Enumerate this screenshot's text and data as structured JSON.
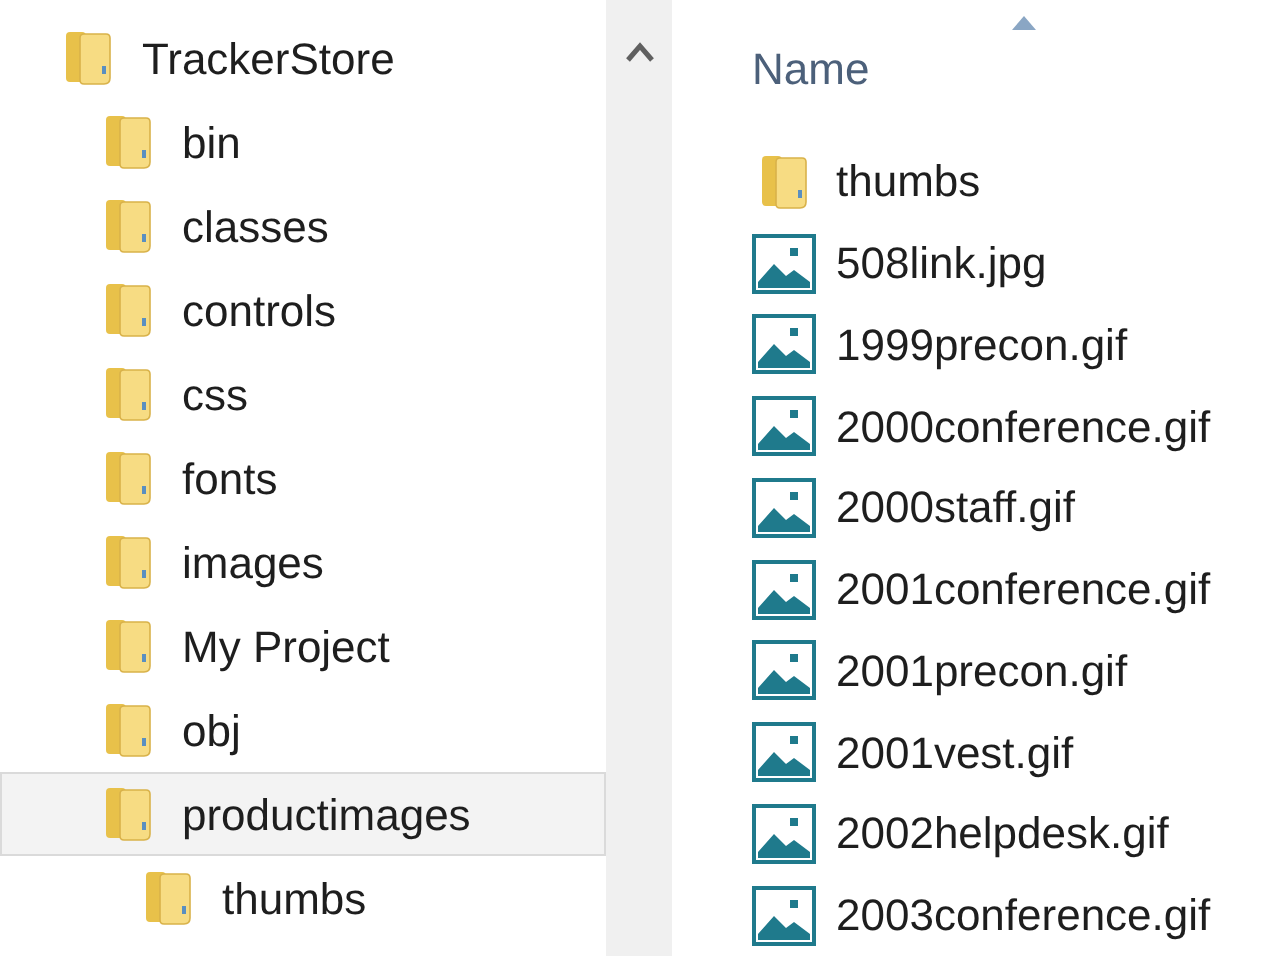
{
  "tree": [
    {
      "label": "TrackerStore",
      "selected": false,
      "children": [
        {
          "label": "bin",
          "selected": false
        },
        {
          "label": "classes",
          "selected": false
        },
        {
          "label": "controls",
          "selected": false
        },
        {
          "label": "css",
          "selected": false
        },
        {
          "label": "fonts",
          "selected": false
        },
        {
          "label": "images",
          "selected": false
        },
        {
          "label": "My Project",
          "selected": false
        },
        {
          "label": "obj",
          "selected": false
        },
        {
          "label": "productimages",
          "selected": true,
          "children": [
            {
              "label": "thumbs",
              "selected": false
            }
          ]
        }
      ]
    }
  ],
  "file_list": {
    "columns": [
      "Name"
    ],
    "items": [
      {
        "kind": "folder",
        "name": "thumbs"
      },
      {
        "kind": "image",
        "name": "508link.jpg"
      },
      {
        "kind": "image",
        "name": "1999precon.gif"
      },
      {
        "kind": "image",
        "name": "2000conference.gif"
      },
      {
        "kind": "image",
        "name": "2000staff.gif"
      },
      {
        "kind": "image",
        "name": "2001conference.gif"
      },
      {
        "kind": "image",
        "name": "2001precon.gif"
      },
      {
        "kind": "image",
        "name": "2001vest.gif"
      },
      {
        "kind": "image",
        "name": "2002helpdesk.gif"
      },
      {
        "kind": "image",
        "name": "2003conference.gif"
      }
    ]
  }
}
